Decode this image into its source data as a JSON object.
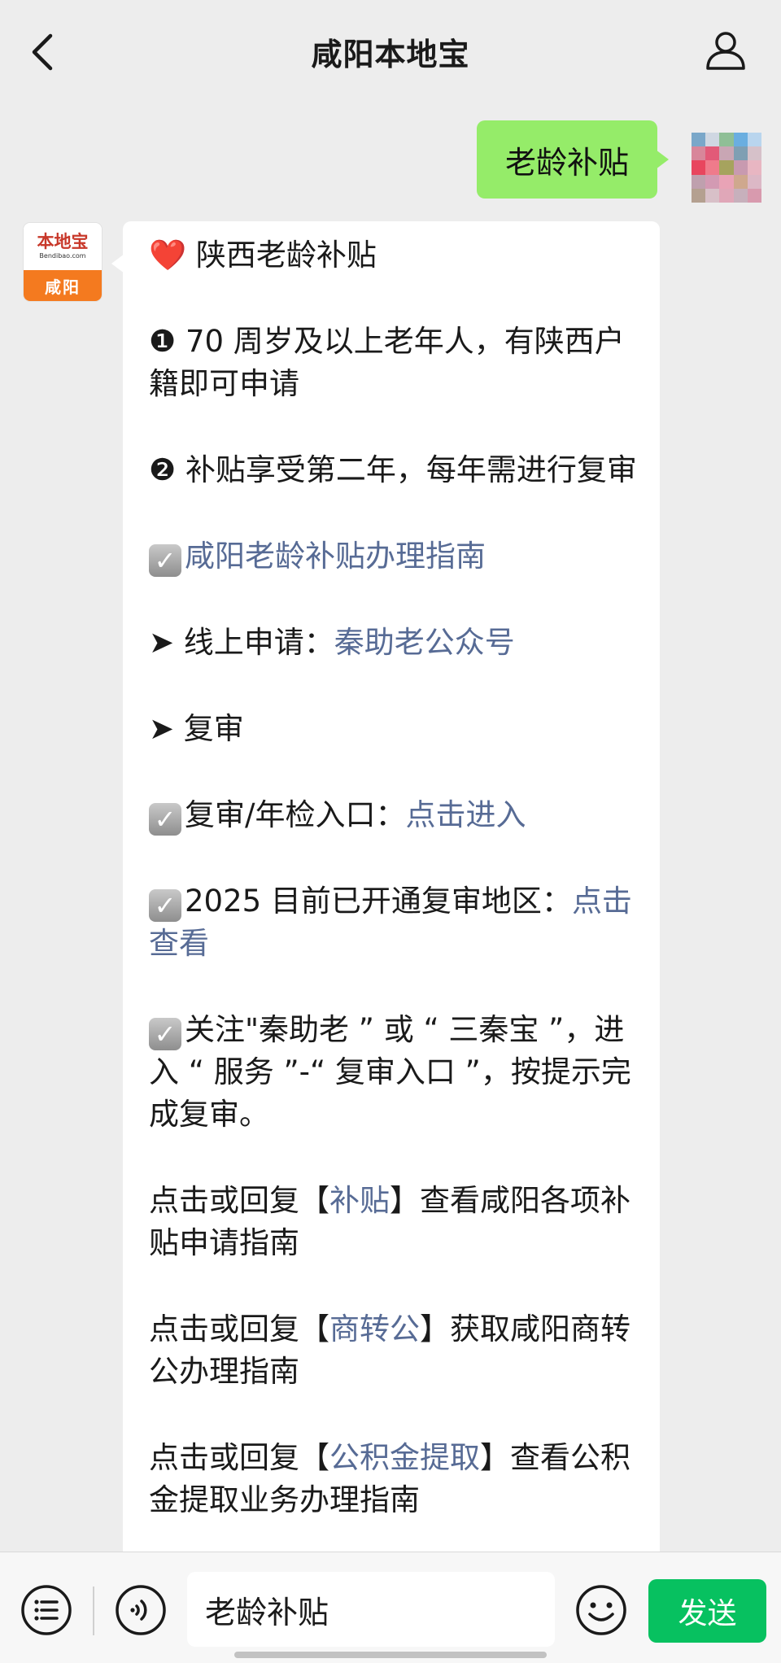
{
  "header": {
    "title": "咸阳本地宝",
    "back_icon": "chevron-left-icon",
    "profile_icon": "person-icon"
  },
  "outgoing": {
    "text": "老龄补贴",
    "bubble_color": "#95ec69"
  },
  "bot": {
    "avatar_brand": "本地宝",
    "avatar_site": "Bendibao.com",
    "avatar_city": "咸阳"
  },
  "message": {
    "heart": "❤️",
    "title": "陕西老龄补贴",
    "point1_marker": "❶",
    "point1": "70 周岁及以上老年人，有陕西户籍即可申请",
    "point2_marker": "❷",
    "point2": "补贴享受第二年，每年需进行复审",
    "guide_link": "咸阳老龄补贴办理指南",
    "online_prefix": "➤ 线上申请：",
    "online_link": "秦助老公众号",
    "review_heading": "➤ 复审",
    "review_entry_prefix": "复审/年检入口：",
    "review_entry_link": "点击进入",
    "regions_prefix": "2025 目前已开通复审地区：",
    "regions_link": "点击查看",
    "follow_text": "关注\"秦助老 ” 或 “ 三秦宝 ”，进入 “ 服务 ”-“ 复审入口 ”，按提示完成复审。",
    "reply1_prefix": "点击或回复【",
    "reply1_link": "补贴",
    "reply1_suffix": "】查看咸阳各项补贴申请指南",
    "reply2_prefix": "点击或回复【",
    "reply2_link": "商转公",
    "reply2_suffix": "】获取咸阳商转公办理指南",
    "reply3_prefix": "点击或回复【",
    "reply3_link": "公积金提取",
    "reply3_suffix": "】查看公积金提取业务办理指南"
  },
  "input_bar": {
    "menu_icon": "list-menu-icon",
    "voice_icon": "voice-icon",
    "input_value": "老龄补贴",
    "emoji_icon": "emoji-icon",
    "send_label": "发送",
    "send_color": "#07c160"
  },
  "colors": {
    "background": "#ededed",
    "link": "#576b95"
  }
}
